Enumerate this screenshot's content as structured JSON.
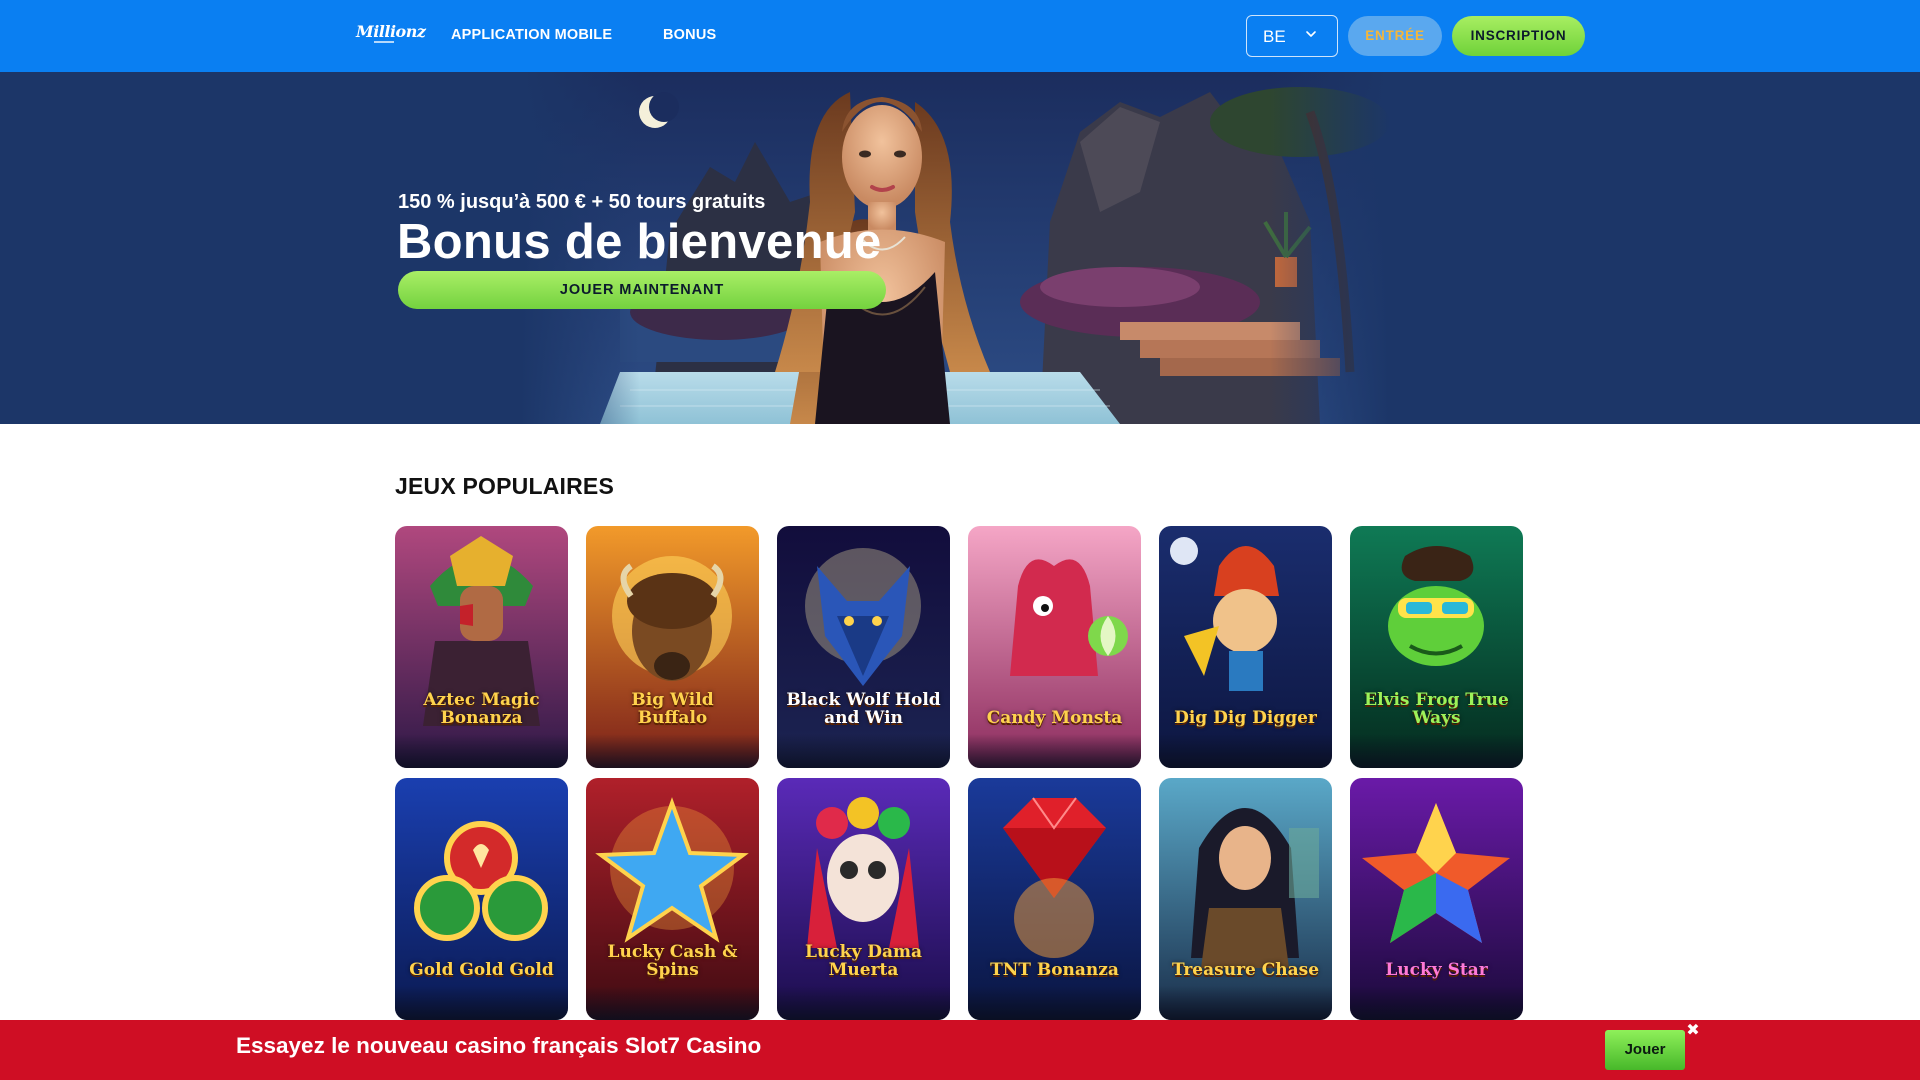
{
  "header": {
    "logo_text": "Millionz",
    "nav": [
      {
        "label": "APPLICATION MOBILE"
      },
      {
        "label": "BONUS"
      }
    ],
    "language": "BE",
    "login_label": "ENTRÉE",
    "register_label": "INSCRIPTION"
  },
  "hero": {
    "subtitle": "150 % jusqu’à 500 € + 50 tours gratuits",
    "title": "Bonus de bienvenue",
    "cta_label": "JOUER MAINTENANT"
  },
  "popular": {
    "title": "JEUX POPULAIRES",
    "games": [
      {
        "name": "Aztec Magic Bonanza"
      },
      {
        "name": "Big Wild Buffalo"
      },
      {
        "name": "Black Wolf Hold and Win"
      },
      {
        "name": "Candy Monsta"
      },
      {
        "name": "Dig Dig Digger"
      },
      {
        "name": "Elvis Frog True Ways"
      },
      {
        "name": "Gold Gold Gold"
      },
      {
        "name": "Lucky Cash & Spins"
      },
      {
        "name": "Lucky Dama Muerta"
      },
      {
        "name": "TNT Bonanza"
      },
      {
        "name": "Treasure Chase"
      },
      {
        "name": "Lucky Star"
      }
    ]
  },
  "promo_bar": {
    "text": "Essayez le nouveau casino français Slot7 Casino",
    "button_label": "Jouer",
    "close_glyph": "✖"
  },
  "colors": {
    "header_bg": "#0a7ff2",
    "hero_bg": "#1c3668",
    "cta_green": "#8ee252",
    "promo_red": "#cf0e24",
    "login_text": "#f4b63a"
  }
}
